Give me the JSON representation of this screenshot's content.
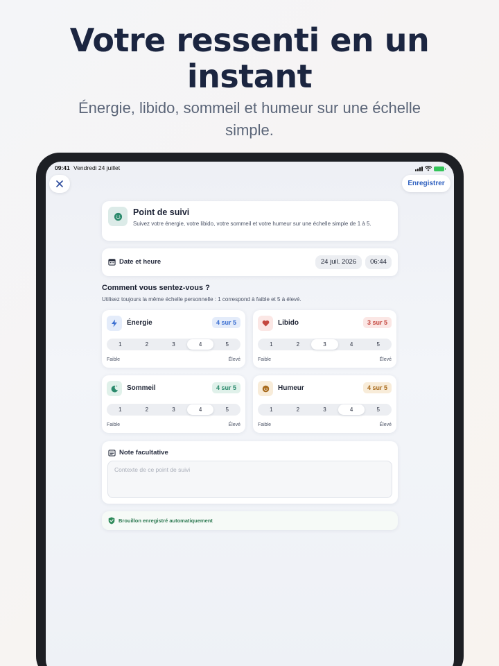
{
  "hero": {
    "title_line1": "Votre ressenti en un",
    "title_line2": "instant",
    "subtitle_line1": "Énergie, libido, sommeil et humeur sur une échelle",
    "subtitle_line2": "simple."
  },
  "statusbar": {
    "time": "09:41",
    "date": "Vendredi 24 juillet"
  },
  "topbar": {
    "close_icon": "close-icon",
    "save_label": "Enregistrer"
  },
  "intro": {
    "icon": "smiley-icon",
    "title": "Point de suivi",
    "description": "Suivez votre énergie, votre libido, votre sommeil et votre humeur sur une échelle simple de 1 à 5."
  },
  "datetime": {
    "icon": "calendar-icon",
    "label": "Date et heure",
    "date": "24 juil. 2026",
    "time": "06:44"
  },
  "question": {
    "title": "Comment vous sentez-vous ?",
    "subtitle": "Utilisez toujours la même échelle personnelle : 1 correspond à faible et 5 à élevé."
  },
  "scale_options": [
    "1",
    "2",
    "3",
    "4",
    "5"
  ],
  "metrics": [
    {
      "name": "Énergie",
      "icon": "lightning-icon",
      "badge": "4 sur 5",
      "value": 4,
      "low": "Faible",
      "high": "Élevé",
      "accent": "#3b6fd1",
      "badge_bg": "#e4ecfa",
      "icon_bg": "#e4ecfa"
    },
    {
      "name": "Libido",
      "icon": "heart-icon",
      "badge": "3 sur 5",
      "value": 3,
      "low": "Faible",
      "high": "Élevé",
      "accent": "#c4473f",
      "badge_bg": "#fbe7e5",
      "icon_bg": "#fbe7e5"
    },
    {
      "name": "Sommeil",
      "icon": "moon-icon",
      "badge": "4 sur 5",
      "value": 4,
      "low": "Faible",
      "high": "Élevé",
      "accent": "#2b8a6c",
      "badge_bg": "#e0f1ea",
      "icon_bg": "#e0f1ea"
    },
    {
      "name": "Humeur",
      "icon": "smiley-icon",
      "badge": "4 sur 5",
      "value": 4,
      "low": "Faible",
      "high": "Élevé",
      "accent": "#a86a1c",
      "badge_bg": "#f8ecd9",
      "icon_bg": "#f8ecd9"
    }
  ],
  "note": {
    "icon": "note-icon",
    "label": "Note facultative",
    "placeholder": "Contexte de ce point de suivi"
  },
  "draft": {
    "icon": "check-shield-icon",
    "text": "Brouillon enregistré automatiquement"
  }
}
